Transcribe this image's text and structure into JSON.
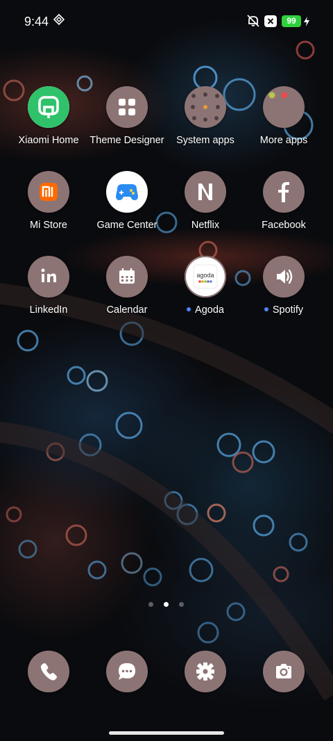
{
  "status_bar": {
    "time": "9:44",
    "battery_level": "99",
    "icons": [
      "data-saver-icon",
      "mute-icon",
      "close-box-icon",
      "charging-bolt-icon"
    ]
  },
  "home_screen": {
    "apps": [
      {
        "label": "Xiaomi Home",
        "icon": "xiaomi-home-icon",
        "new_dot": false
      },
      {
        "label": "Theme Designer",
        "icon": "grid-icon",
        "new_dot": false
      },
      {
        "label": "System apps",
        "icon": "folder-icon",
        "new_dot": false
      },
      {
        "label": "More apps",
        "icon": "folder-icon",
        "new_dot": false
      },
      {
        "label": "Mi Store",
        "icon": "mi-store-icon",
        "new_dot": false
      },
      {
        "label": "Game Center",
        "icon": "gamepad-icon",
        "new_dot": false
      },
      {
        "label": "Netflix",
        "icon": "netflix-icon",
        "new_dot": false
      },
      {
        "label": "Facebook",
        "icon": "facebook-icon",
        "new_dot": false
      },
      {
        "label": "LinkedIn",
        "icon": "linkedin-icon",
        "new_dot": false
      },
      {
        "label": "Calendar",
        "icon": "calendar-icon",
        "new_dot": false
      },
      {
        "label": "Agoda",
        "icon": "agoda-icon",
        "new_dot": true
      },
      {
        "label": "Spotify",
        "icon": "speaker-icon",
        "new_dot": true
      }
    ],
    "agoda_wordmark": "agoda",
    "page_indicator": {
      "pages": 3,
      "current": 2
    }
  },
  "dock": {
    "items": [
      "phone-icon",
      "messages-icon",
      "settings-icon",
      "camera-icon"
    ]
  },
  "colors": {
    "icon_background": "#8d7474",
    "battery_green": "#2fd13d",
    "xiaomi_green": "#2fc26b",
    "mi_orange": "#ff6a00",
    "notification_dot": "#4a86f7"
  }
}
